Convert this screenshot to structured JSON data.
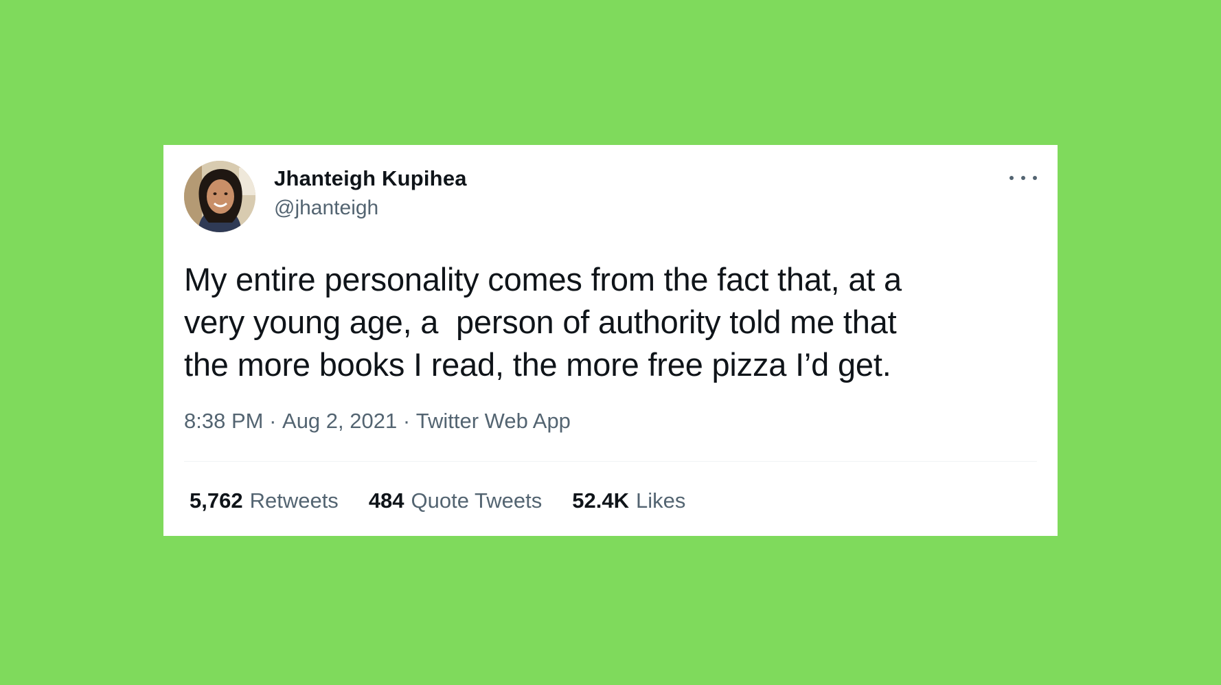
{
  "colors": {
    "background": "#7fda5c",
    "card": "#ffffff",
    "text_primary": "#0f1419",
    "text_secondary": "#536471"
  },
  "author": {
    "display_name": "Jhanteigh Kupihea",
    "handle": "@jhanteigh",
    "avatar_icon": "profile-photo"
  },
  "more_icon": "ellipsis-icon",
  "tweet": {
    "text": "My entire personality comes from the fact that, at a\nvery young age, a  person of authority told me that\nthe more books I read, the more free pizza I’d get.",
    "time": "8:38 PM",
    "date": "Aug 2, 2021",
    "source": "Twitter Web App",
    "separator": " · "
  },
  "stats": {
    "retweets": {
      "count": "5,762",
      "label": "Retweets"
    },
    "quotes": {
      "count": "484",
      "label": "Quote Tweets"
    },
    "likes": {
      "count": "52.4K",
      "label": "Likes"
    }
  }
}
